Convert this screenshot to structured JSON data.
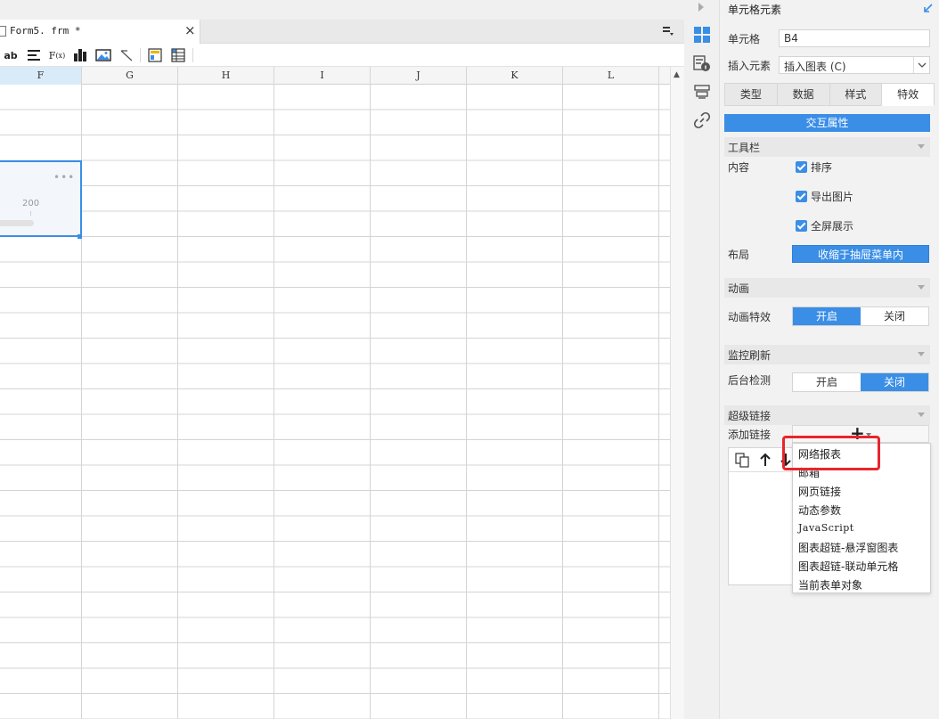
{
  "editor": {
    "tab_title": "Form5. frm *",
    "columns": [
      "F",
      "G",
      "H",
      "I",
      "J",
      "K",
      "L"
    ],
    "selected_column": "F",
    "chart_cell_value": "200"
  },
  "panel": {
    "title": "单元格元素",
    "cell_label": "单元格",
    "cell_value": "B4",
    "insert_label": "插入元素",
    "insert_value": "插入图表 (C)",
    "tabs": [
      {
        "label": "类型",
        "active": false
      },
      {
        "label": "数据",
        "active": false
      },
      {
        "label": "样式",
        "active": false
      },
      {
        "label": "特效",
        "active": true
      }
    ],
    "interact_bar": "交互属性",
    "toolbar_section": {
      "title": "工具栏",
      "content_label": "内容",
      "options": [
        {
          "label": "排序",
          "checked": true
        },
        {
          "label": "导出图片",
          "checked": true
        },
        {
          "label": "全屏展示",
          "checked": true
        }
      ],
      "layout_label": "布局",
      "layout_value": "收缩于抽屉菜单内"
    },
    "animation_section": {
      "title": "动画",
      "effect_label": "动画特效",
      "on_label": "开启",
      "off_label": "关闭",
      "selected": "on"
    },
    "monitor_section": {
      "title": "监控刷新",
      "detect_label": "后台检测",
      "on_label": "开启",
      "off_label": "关闭",
      "selected": "off"
    },
    "hyperlink_section": {
      "title": "超级链接",
      "add_label": "添加链接",
      "add_icon": "+"
    },
    "dropdown_items": [
      "网络报表",
      "邮箱",
      "网页链接",
      "动态参数",
      "JavaScript",
      "图表超链-悬浮窗图表",
      "图表超链-联动单元格",
      "当前表单对象"
    ],
    "highlight_color": "#e8262b",
    "accent_color": "#3a8ee6"
  }
}
